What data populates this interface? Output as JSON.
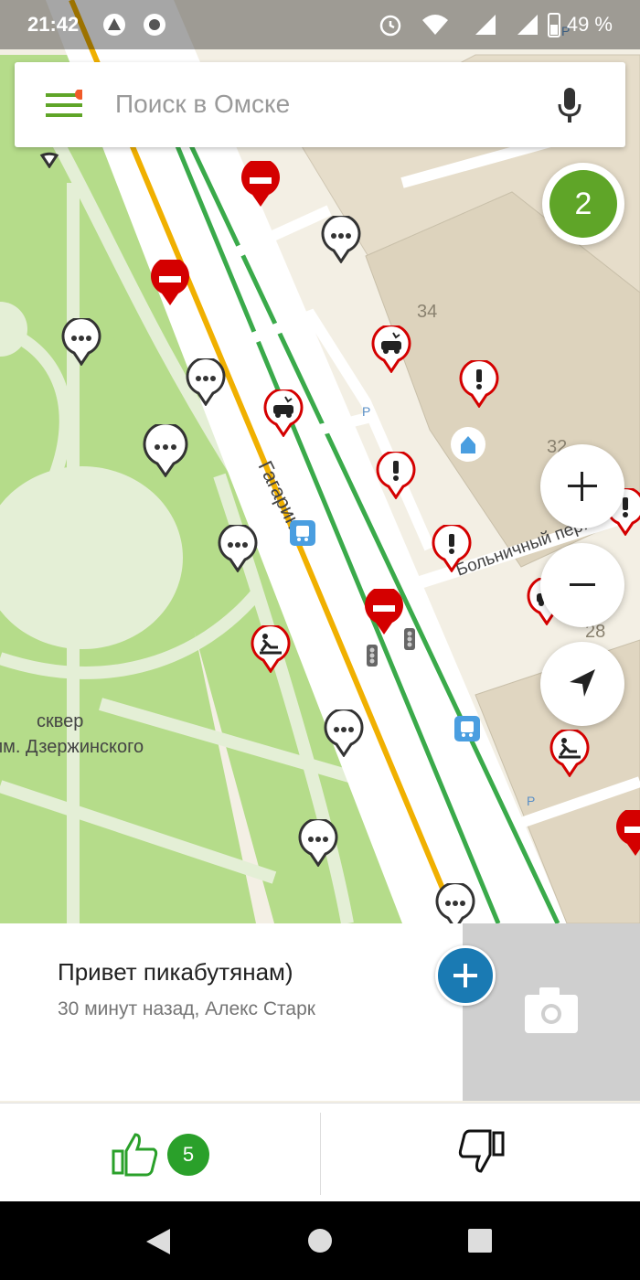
{
  "status_bar": {
    "time": "21:42",
    "battery": "49 %"
  },
  "search": {
    "placeholder": "Поиск в Омске"
  },
  "map": {
    "street_gagarina": "Гагарина",
    "street_bolnichny": "Больничный пер.",
    "park_line1": "сквер",
    "park_line2": "им. Дзержинского",
    "house_34": "34",
    "house_32": "32",
    "house_28": "28",
    "parking": "P"
  },
  "counter": "2",
  "card": {
    "title": "Привет пикабутянам)",
    "subtitle": "30 минут назад, Алекс Старк"
  },
  "votes": {
    "likes": "5"
  },
  "colors": {
    "accent_green": "#5fa528",
    "like_green": "#2aa02a",
    "plus_blue": "#1a7ab3",
    "event_red": "#d40000",
    "road_yellow": "#f0b000"
  }
}
